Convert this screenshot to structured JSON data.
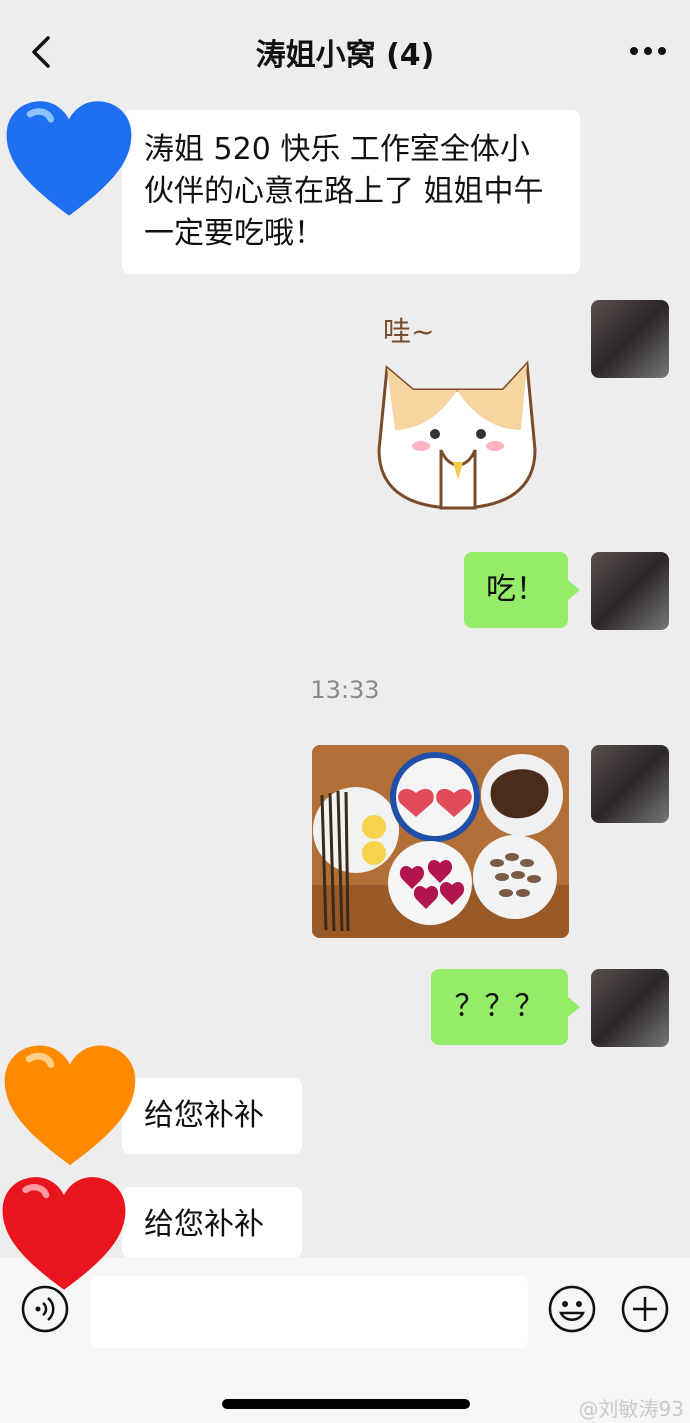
{
  "header": {
    "title": "涛姐小窝 (4)",
    "back_icon": "chevron-left-icon",
    "more_icon": "more-dots-icon"
  },
  "messages": [
    {
      "side": "left",
      "text": "涛姐 520 快乐 工作室全体小伙伴的心意在路上了 姐姐中午一定要吃哦！"
    },
    {
      "side": "right",
      "type": "sticker",
      "sticker_text": "哇~"
    },
    {
      "side": "right",
      "text": "吃！"
    },
    {
      "side": "center",
      "type": "timestamp",
      "text": "13:33"
    },
    {
      "side": "right",
      "type": "image",
      "description_icon": "food-photo"
    },
    {
      "side": "right",
      "text": "？？？"
    },
    {
      "side": "left",
      "text": "给您补补"
    },
    {
      "side": "left",
      "text": "给您补补"
    }
  ],
  "toolbar": {
    "voice_icon": "voice-icon",
    "emoji_icon": "emoji-icon",
    "plus_icon": "plus-icon"
  },
  "watermark": "@刘敏涛93",
  "colors": {
    "background": "#ededed",
    "right_bubble": "#95ec69",
    "left_bubble": "#ffffff",
    "blue_heart": "#1e6ff2",
    "orange_heart": "#ff8a00",
    "red_heart": "#e8141e"
  }
}
